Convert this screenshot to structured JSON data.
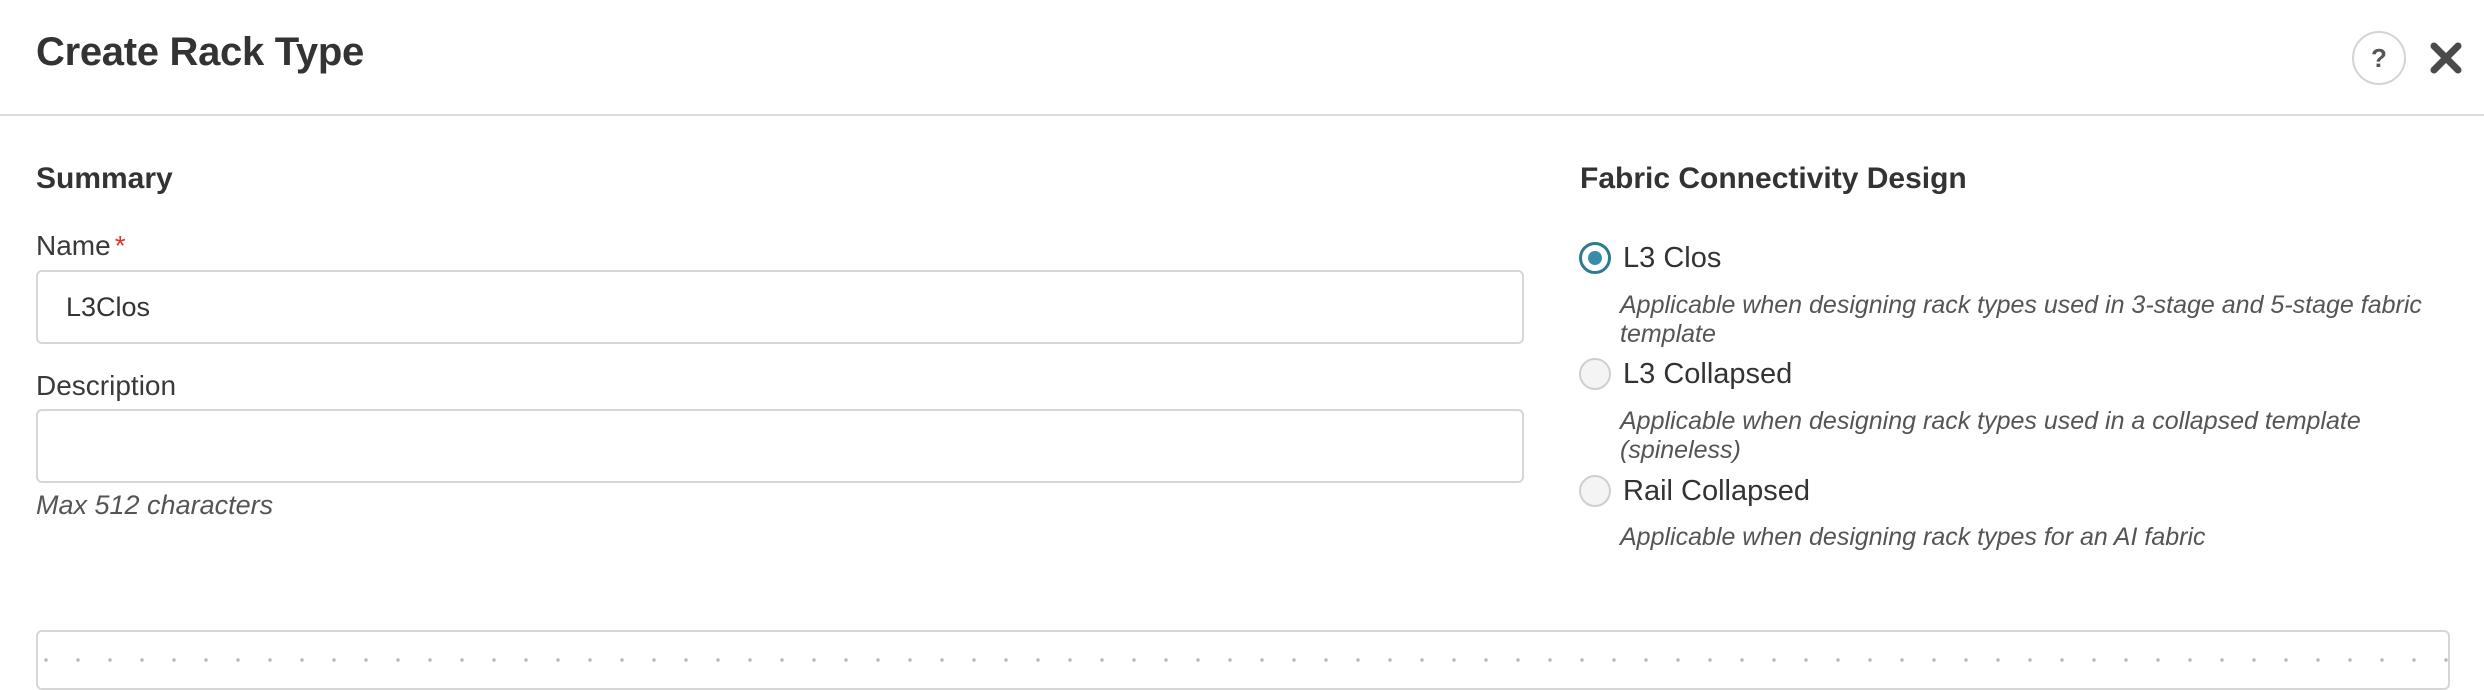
{
  "dialog": {
    "title": "Create Rack Type",
    "help_label": "?"
  },
  "summary": {
    "heading": "Summary",
    "name_label": "Name",
    "name_required_marker": "*",
    "name_value": "L3Clos",
    "description_label": "Description",
    "description_value": "",
    "description_hint": "Max 512 characters"
  },
  "fabric": {
    "heading": "Fabric Connectivity Design",
    "options": [
      {
        "label": "L3 Clos",
        "description": "Applicable when designing rack types used in 3-stage and 5-stage fabric template",
        "selected": true
      },
      {
        "label": "L3 Collapsed",
        "description": "Applicable when designing rack types used in a collapsed template (spineless)",
        "selected": false
      },
      {
        "label": "Rail Collapsed",
        "description": "Applicable when designing rack types for an AI fabric",
        "selected": false
      }
    ]
  },
  "colors": {
    "accent": "#2e7b91",
    "required": "#d9352b",
    "border": "#d6d6d6"
  }
}
